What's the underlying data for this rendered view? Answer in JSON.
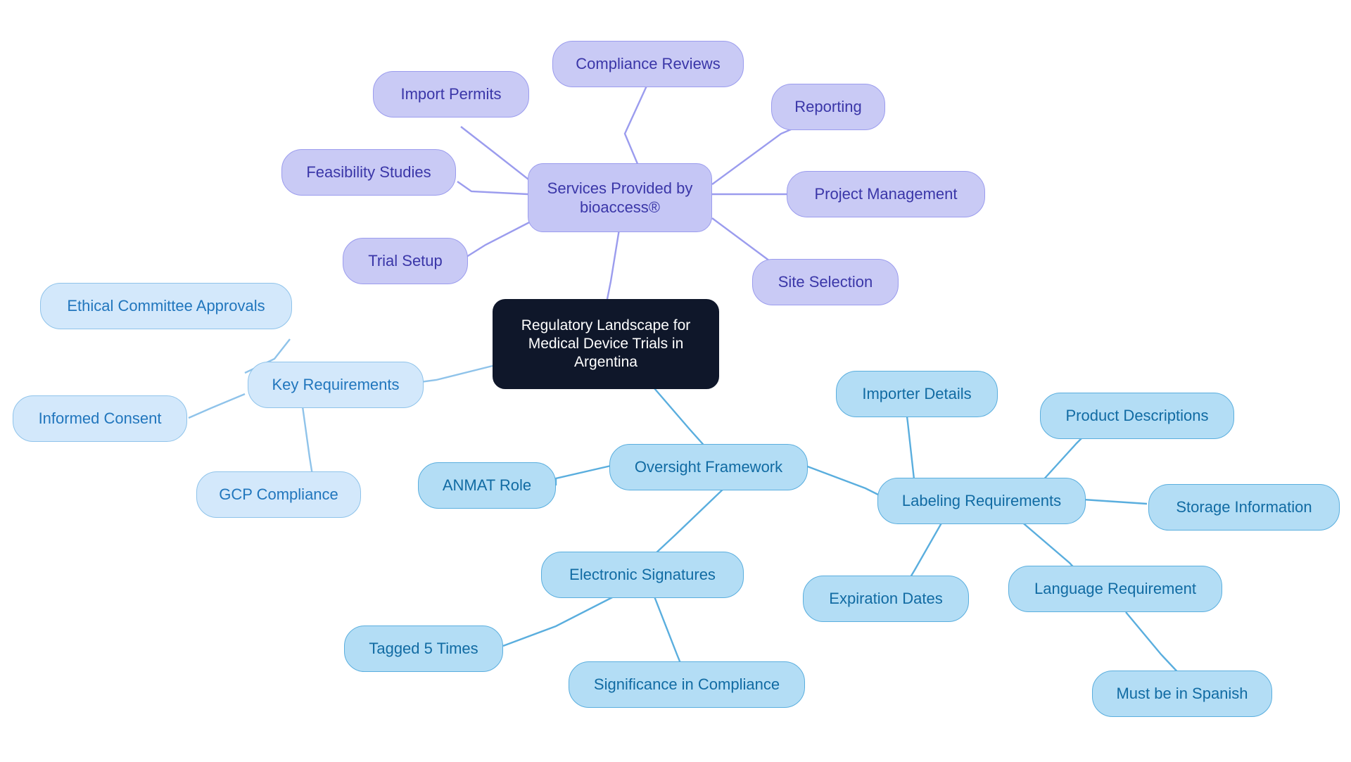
{
  "diagram": {
    "type": "mindmap",
    "background": "#ffffff",
    "root": {
      "id": "root",
      "label": "Regulatory Landscape for Medical Device Trials in Argentina",
      "fill": "#0f172a",
      "text_color": "#ffffff"
    },
    "palettes": {
      "services": {
        "fill": "#c9caf5",
        "border": "#9b9cee",
        "text": "#3a36a8"
      },
      "key_requirements": {
        "fill": "#d3e8fb",
        "border": "#8fc3ea",
        "text": "#2176bd"
      },
      "oversight": {
        "fill": "#b3ddf5",
        "border": "#5aaede",
        "text": "#116ba3"
      }
    },
    "branches": [
      {
        "id": "services",
        "label": "Services Provided by bioaccess®",
        "palette": "services",
        "children": [
          {
            "id": "compliance-reviews",
            "label": "Compliance Reviews"
          },
          {
            "id": "import-permits",
            "label": "Import Permits"
          },
          {
            "id": "feasibility-studies",
            "label": "Feasibility Studies"
          },
          {
            "id": "trial-setup",
            "label": "Trial Setup"
          },
          {
            "id": "reporting",
            "label": "Reporting"
          },
          {
            "id": "project-management",
            "label": "Project Management"
          },
          {
            "id": "site-selection",
            "label": "Site Selection"
          }
        ]
      },
      {
        "id": "key-requirements",
        "label": "Key Requirements",
        "palette": "key_requirements",
        "children": [
          {
            "id": "ethical-committee-approvals",
            "label": "Ethical Committee Approvals"
          },
          {
            "id": "informed-consent",
            "label": "Informed Consent"
          },
          {
            "id": "gcp-compliance",
            "label": "GCP Compliance"
          }
        ]
      },
      {
        "id": "oversight-framework",
        "label": "Oversight Framework",
        "palette": "oversight",
        "children": [
          {
            "id": "anmat-role",
            "label": "ANMAT Role"
          },
          {
            "id": "electronic-signatures",
            "label": "Electronic Signatures",
            "children": [
              {
                "id": "tagged-5-times",
                "label": "Tagged 5 Times"
              },
              {
                "id": "significance-in-compliance",
                "label": "Significance in Compliance"
              }
            ]
          },
          {
            "id": "labeling-requirements",
            "label": "Labeling Requirements",
            "children": [
              {
                "id": "importer-details",
                "label": "Importer Details"
              },
              {
                "id": "product-descriptions",
                "label": "Product Descriptions"
              },
              {
                "id": "storage-information",
                "label": "Storage Information"
              },
              {
                "id": "expiration-dates",
                "label": "Expiration Dates"
              },
              {
                "id": "language-requirement",
                "label": "Language Requirement",
                "children": [
                  {
                    "id": "must-be-in-spanish",
                    "label": "Must be in Spanish"
                  }
                ]
              }
            ]
          }
        ]
      }
    ]
  }
}
